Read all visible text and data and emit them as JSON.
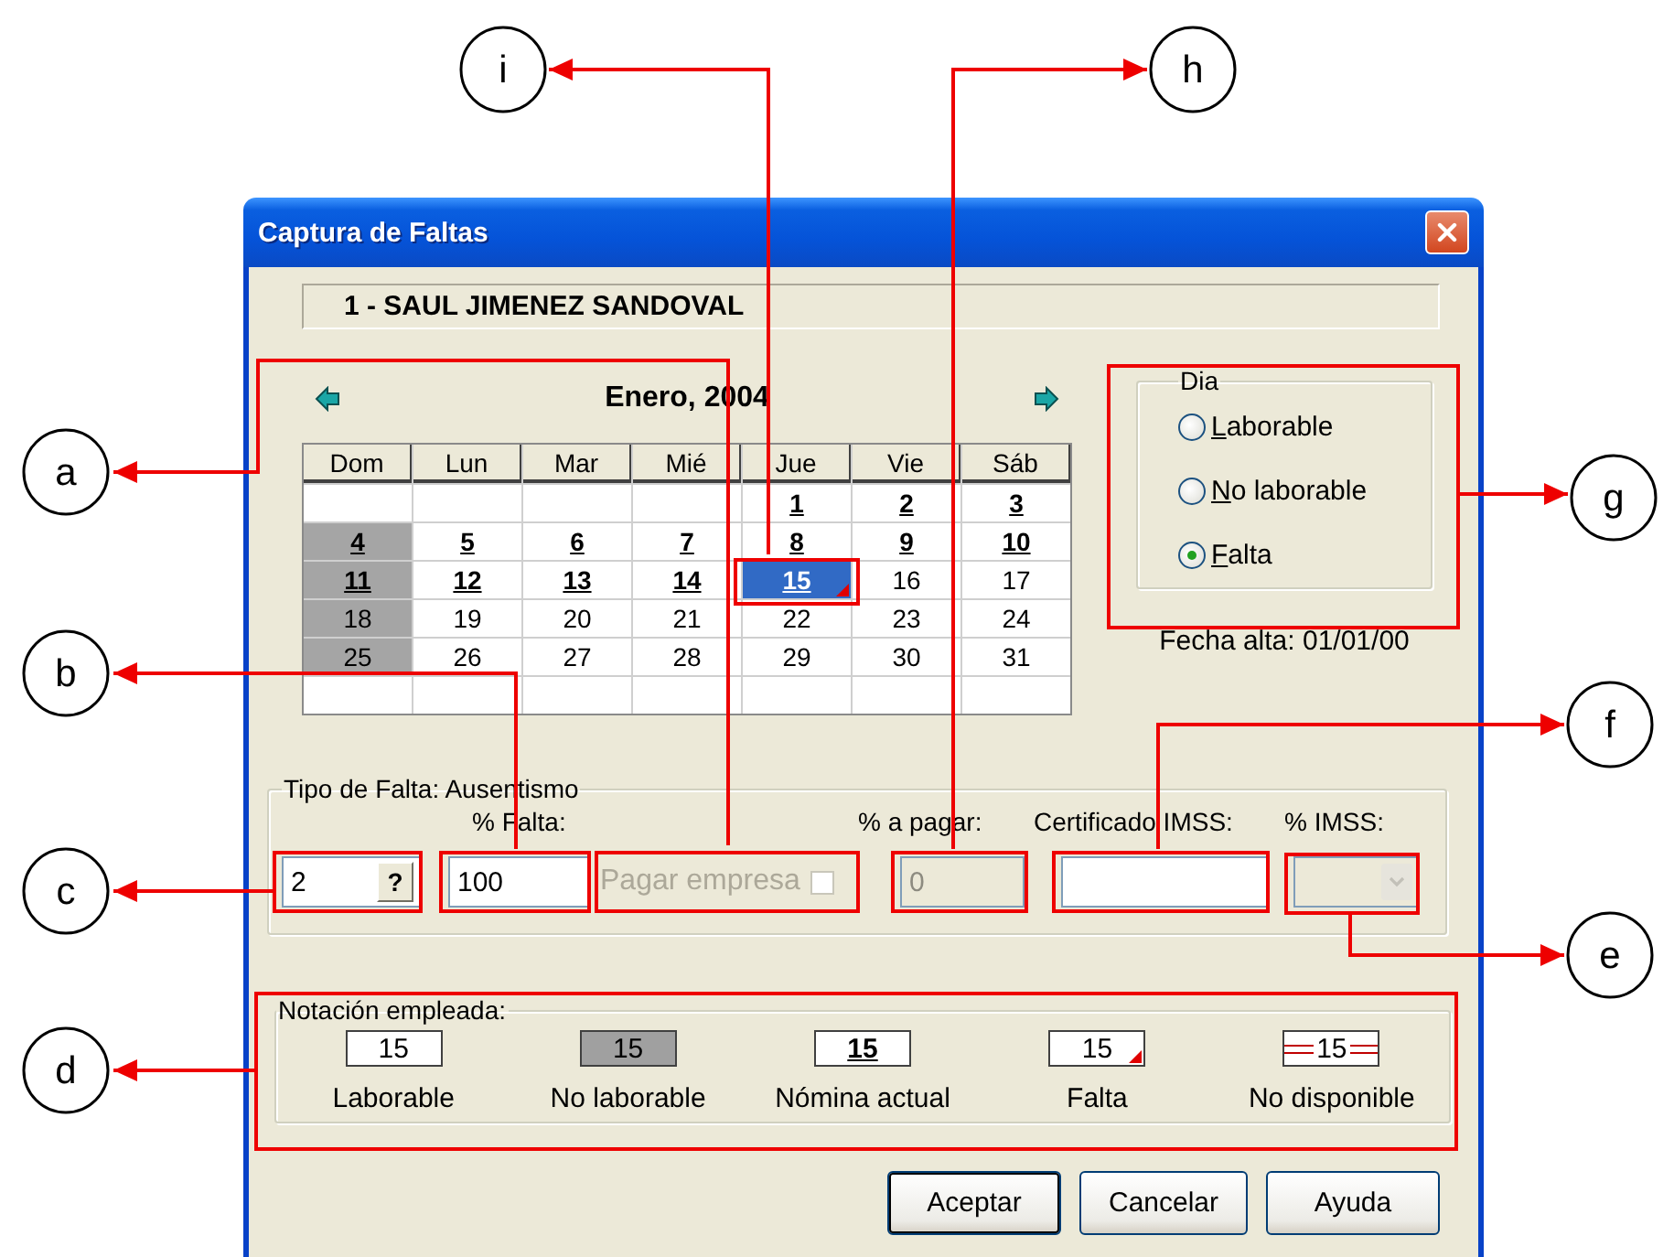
{
  "window": {
    "title": "Captura de Faltas"
  },
  "employee": "1 - SAUL JIMENEZ SANDOVAL",
  "calendar": {
    "month": "Enero, 2004",
    "columns": [
      "Dom",
      "Lun",
      "Mar",
      "Mié",
      "Jue",
      "Vie",
      "Sáb"
    ],
    "weeks": [
      [
        {
          "kind": "blank"
        },
        {
          "kind": "blank"
        },
        {
          "kind": "blank"
        },
        {
          "kind": "blank"
        },
        {
          "kind": "day",
          "day": "1",
          "nonworking": false,
          "payroll": true,
          "absence": false,
          "selected": false
        },
        {
          "kind": "day",
          "day": "2",
          "nonworking": false,
          "payroll": true,
          "absence": false,
          "selected": false
        },
        {
          "kind": "day",
          "day": "3",
          "nonworking": false,
          "payroll": true,
          "absence": false,
          "selected": false
        }
      ],
      [
        {
          "kind": "day",
          "day": "4",
          "nonworking": true,
          "payroll": true,
          "absence": false,
          "selected": false
        },
        {
          "kind": "day",
          "day": "5",
          "nonworking": false,
          "payroll": true,
          "absence": false,
          "selected": false
        },
        {
          "kind": "day",
          "day": "6",
          "nonworking": false,
          "payroll": true,
          "absence": false,
          "selected": false
        },
        {
          "kind": "day",
          "day": "7",
          "nonworking": false,
          "payroll": true,
          "absence": false,
          "selected": false
        },
        {
          "kind": "day",
          "day": "8",
          "nonworking": false,
          "payroll": true,
          "absence": false,
          "selected": false
        },
        {
          "kind": "day",
          "day": "9",
          "nonworking": false,
          "payroll": true,
          "absence": false,
          "selected": false
        },
        {
          "kind": "day",
          "day": "10",
          "nonworking": false,
          "payroll": true,
          "absence": false,
          "selected": false
        }
      ],
      [
        {
          "kind": "day",
          "day": "11",
          "nonworking": true,
          "payroll": true,
          "absence": false,
          "selected": false
        },
        {
          "kind": "day",
          "day": "12",
          "nonworking": false,
          "payroll": true,
          "absence": false,
          "selected": false
        },
        {
          "kind": "day",
          "day": "13",
          "nonworking": false,
          "payroll": true,
          "absence": false,
          "selected": false
        },
        {
          "kind": "day",
          "day": "14",
          "nonworking": false,
          "payroll": true,
          "absence": false,
          "selected": false
        },
        {
          "kind": "day",
          "day": "15",
          "nonworking": false,
          "payroll": true,
          "absence": true,
          "selected": true
        },
        {
          "kind": "day",
          "day": "16",
          "nonworking": false,
          "payroll": false,
          "absence": false,
          "selected": false
        },
        {
          "kind": "day",
          "day": "17",
          "nonworking": false,
          "payroll": false,
          "absence": false,
          "selected": false
        }
      ],
      [
        {
          "kind": "day",
          "day": "18",
          "nonworking": true,
          "payroll": false,
          "absence": false,
          "selected": false
        },
        {
          "kind": "day",
          "day": "19",
          "nonworking": false,
          "payroll": false,
          "absence": false,
          "selected": false
        },
        {
          "kind": "day",
          "day": "20",
          "nonworking": false,
          "payroll": false,
          "absence": false,
          "selected": false
        },
        {
          "kind": "day",
          "day": "21",
          "nonworking": false,
          "payroll": false,
          "absence": false,
          "selected": false
        },
        {
          "kind": "day",
          "day": "22",
          "nonworking": false,
          "payroll": false,
          "absence": false,
          "selected": false
        },
        {
          "kind": "day",
          "day": "23",
          "nonworking": false,
          "payroll": false,
          "absence": false,
          "selected": false
        },
        {
          "kind": "day",
          "day": "24",
          "nonworking": false,
          "payroll": false,
          "absence": false,
          "selected": false
        }
      ],
      [
        {
          "kind": "day",
          "day": "25",
          "nonworking": true,
          "payroll": false,
          "absence": false,
          "selected": false
        },
        {
          "kind": "day",
          "day": "26",
          "nonworking": false,
          "payroll": false,
          "absence": false,
          "selected": false
        },
        {
          "kind": "day",
          "day": "27",
          "nonworking": false,
          "payroll": false,
          "absence": false,
          "selected": false
        },
        {
          "kind": "day",
          "day": "28",
          "nonworking": false,
          "payroll": false,
          "absence": false,
          "selected": false
        },
        {
          "kind": "day",
          "day": "29",
          "nonworking": false,
          "payroll": false,
          "absence": false,
          "selected": false
        },
        {
          "kind": "day",
          "day": "30",
          "nonworking": false,
          "payroll": false,
          "absence": false,
          "selected": false
        },
        {
          "kind": "day",
          "day": "31",
          "nonworking": false,
          "payroll": false,
          "absence": false,
          "selected": false
        }
      ],
      [
        {
          "kind": "blank"
        },
        {
          "kind": "blank"
        },
        {
          "kind": "blank"
        },
        {
          "kind": "blank"
        },
        {
          "kind": "blank"
        },
        {
          "kind": "blank"
        },
        {
          "kind": "blank"
        }
      ]
    ]
  },
  "day_type": {
    "legend": "Dia",
    "options": [
      {
        "label": "Laborable",
        "selected": false
      },
      {
        "label": "No laborable",
        "selected": false
      },
      {
        "label": "Falta",
        "selected": true
      }
    ]
  },
  "registration_date": "Fecha alta: 01/01/00",
  "absence_type": {
    "legend": "Tipo de Falta: Ausentismo",
    "code": {
      "value": "2",
      "button": "?"
    },
    "percent": {
      "label": "% Falta:",
      "value": "100"
    },
    "company_pays": {
      "label": "Pagar empresa",
      "checked": false,
      "disabled": true
    },
    "pay_percent": {
      "label": "% a pagar:",
      "value": "0",
      "disabled": true
    },
    "certificate": {
      "label": "Certificado IMSS:"
    },
    "imss_percent": {
      "label": "% IMSS:",
      "disabled": true
    }
  },
  "notation": {
    "legend": "Notación empleada:",
    "items": [
      {
        "sample": "15",
        "label": "Laborable",
        "kind": "working"
      },
      {
        "sample": "15",
        "label": "No laborable",
        "kind": "nonworking"
      },
      {
        "sample": "15",
        "label": "Nómina actual",
        "kind": "payroll"
      },
      {
        "sample": "15",
        "label": "Falta",
        "kind": "absence"
      },
      {
        "sample": "15",
        "label": "No disponible",
        "kind": "unavailable"
      }
    ]
  },
  "buttons": [
    {
      "label": "Aceptar",
      "default": true
    },
    {
      "label": "Cancelar",
      "default": false
    },
    {
      "label": "Ayuda",
      "default": false
    }
  ],
  "callouts": [
    {
      "letter": "i"
    },
    {
      "letter": "h"
    },
    {
      "letter": "a"
    },
    {
      "letter": "g"
    },
    {
      "letter": "b"
    },
    {
      "letter": "f"
    },
    {
      "letter": "c"
    },
    {
      "letter": "e"
    },
    {
      "letter": "d"
    }
  ]
}
